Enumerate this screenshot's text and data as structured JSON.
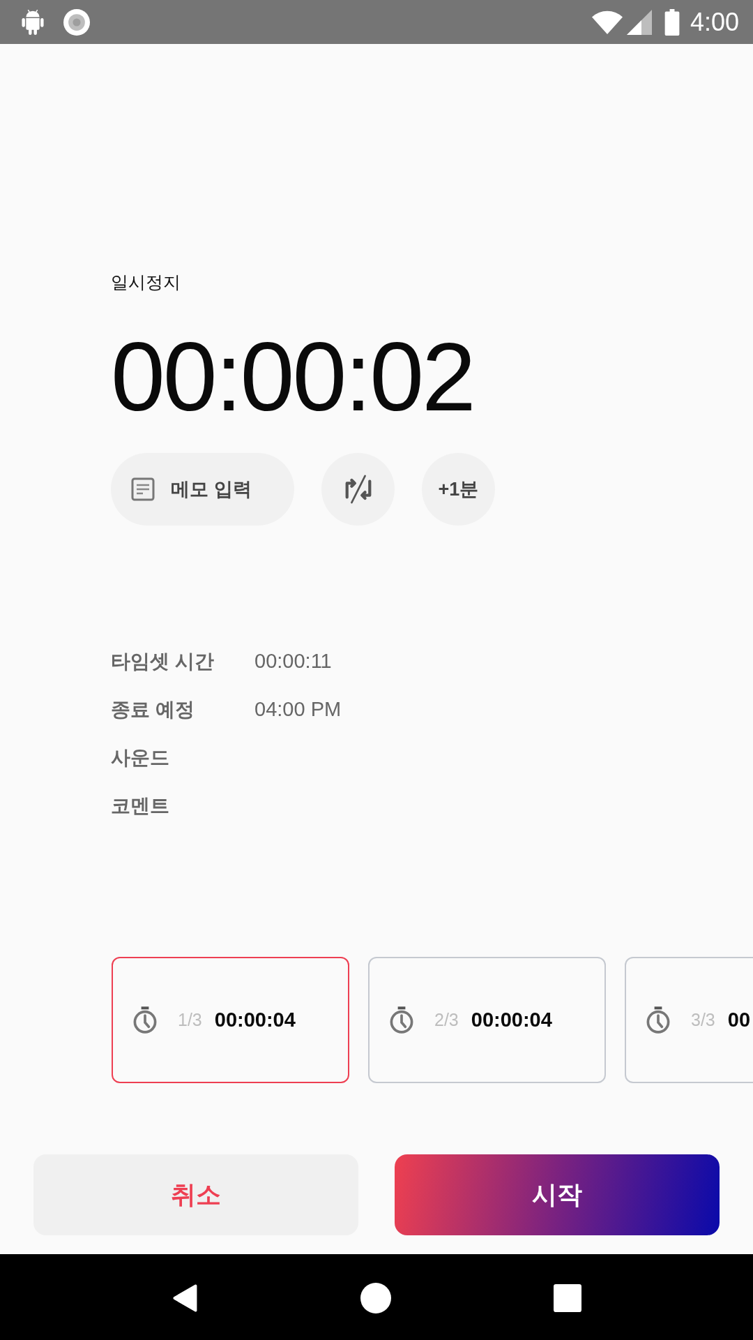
{
  "status_bar": {
    "time": "4:00"
  },
  "timer": {
    "state_label": "일시정지",
    "elapsed": "00:00:02"
  },
  "actions": [
    {
      "kind": "memo",
      "label": "메모 입력"
    },
    {
      "kind": "swap"
    },
    {
      "kind": "add",
      "label": "+1분"
    }
  ],
  "details": [
    {
      "label": "타임셋 시간",
      "value": "00:00:11"
    },
    {
      "label": "종료 예정",
      "value": "04:00 PM"
    },
    {
      "label": "사운드"
    },
    {
      "label": "코멘트"
    }
  ],
  "timesets": [
    {
      "position": "1/3",
      "duration": "00:00:04",
      "selected": true
    },
    {
      "position": "2/3",
      "duration": "00:00:04",
      "selected": false
    },
    {
      "position": "3/3",
      "duration": "00",
      "selected": false
    }
  ],
  "buttons": [
    {
      "kind": "cancel",
      "label": "취소"
    },
    {
      "kind": "start",
      "label": "시작"
    }
  ]
}
